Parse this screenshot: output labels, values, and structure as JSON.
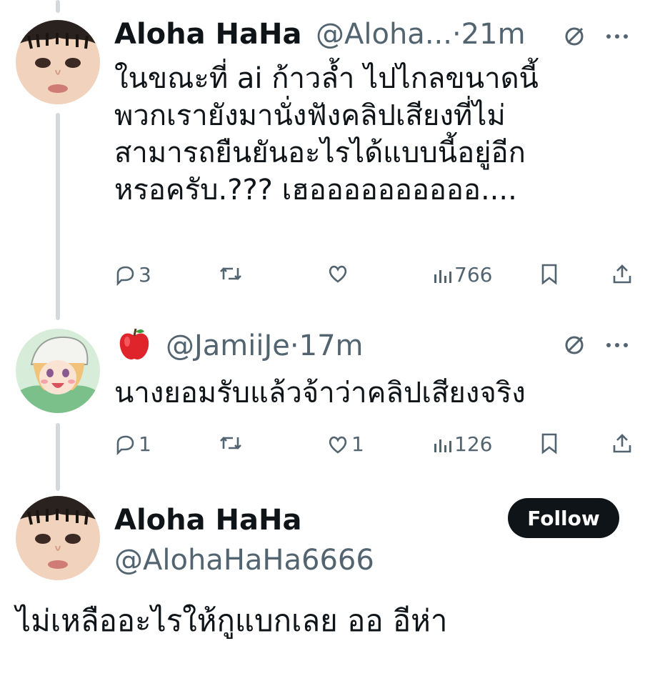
{
  "tweet1": {
    "name": "Aloha HaHa",
    "handle_time": "@Aloha...·21m",
    "lines": [
      "ในขณะที่ ai ก้าวล้ำ ไปไกลขนาดนี้",
      "พวกเรายังมานั่งฟังคลิปเสียงที่ไม่",
      "สามารถยืนยันอะไรได้แบบนี้อยู่อีก",
      "หรอครับ.??? เฮออออออออออ...."
    ],
    "replies": "3",
    "retweets": "",
    "likes": "",
    "views": "766"
  },
  "tweet2": {
    "emoji": "🍎",
    "handle_time": "@JamiiJe·17m",
    "text": "นางยอมรับแล้วจ้าว่าคลิปเสียงจริง",
    "replies": "1",
    "retweets": "",
    "likes": "1",
    "views": "126"
  },
  "profile": {
    "name": "Aloha HaHa",
    "handle": "@AlohaHaHa6666",
    "follow_label": "Follow"
  },
  "caption": "ไม่เหลืออะไรให้กูแบกเลย ออ อีห่า",
  "icons": [
    "no-entry-icon",
    "more-icon",
    "reply-icon",
    "retweet-icon",
    "like-icon",
    "views-icon",
    "bookmark-icon",
    "share-icon"
  ]
}
